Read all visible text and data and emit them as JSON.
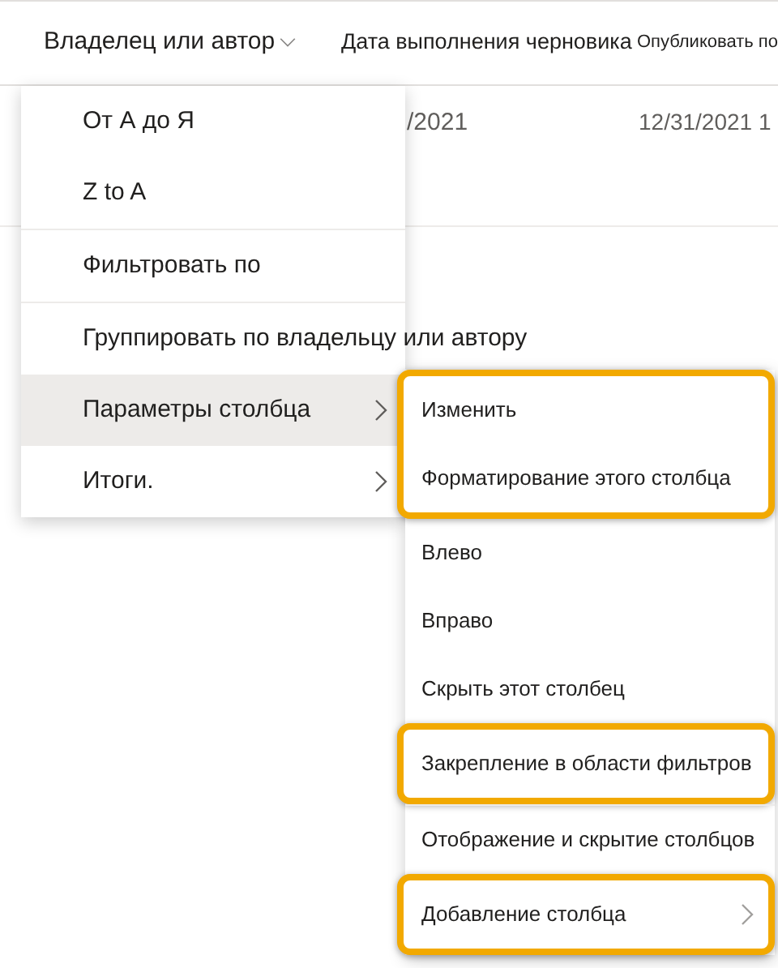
{
  "columns": [
    {
      "label": "Владелец или автор",
      "dropdown": true
    },
    {
      "label": "Дата выполнения черновика",
      "dropdown": false
    },
    {
      "label": "Опубликовать по",
      "dropdown": false
    }
  ],
  "rows": [
    {
      "column_2": "/2021",
      "column_3": "12/31/2021 1"
    }
  ],
  "menu": {
    "items": [
      {
        "kind": "item",
        "label": "От А до Я",
        "selected": false,
        "has_submenu": false
      },
      {
        "kind": "item",
        "label": "Z to A",
        "selected": false,
        "has_submenu": false
      },
      {
        "kind": "divider"
      },
      {
        "kind": "item",
        "label": "Фильтровать по",
        "selected": false,
        "has_submenu": false
      },
      {
        "kind": "divider"
      },
      {
        "kind": "item",
        "label": "Группировать по владельцу или автору",
        "selected": false,
        "has_submenu": false
      },
      {
        "kind": "item",
        "label": "Параметры столбца",
        "selected": true,
        "has_submenu": true
      },
      {
        "kind": "item",
        "label": "Итоги.",
        "selected": false,
        "has_submenu": true
      }
    ]
  },
  "submenu": {
    "items": [
      {
        "kind": "item",
        "label": "Изменить",
        "highlighted": true,
        "has_submenu": false
      },
      {
        "kind": "item",
        "label": "Форматирование этого столбца",
        "highlighted": true,
        "has_submenu": false
      },
      {
        "kind": "item",
        "label": "Влево",
        "highlighted": false,
        "has_submenu": false
      },
      {
        "kind": "item",
        "label": "Вправо",
        "highlighted": false,
        "has_submenu": false
      },
      {
        "kind": "item",
        "label": "Скрыть этот столбец",
        "highlighted": false,
        "has_submenu": false
      },
      {
        "kind": "item",
        "label": "Закрепление в области фильтров",
        "highlighted": true,
        "has_submenu": false
      },
      {
        "kind": "divider"
      },
      {
        "kind": "item",
        "label": "Отображение и скрытие столбцов",
        "highlighted": false,
        "has_submenu": false
      },
      {
        "kind": "item",
        "label": "Добавление столбца",
        "highlighted": true,
        "has_submenu": true
      }
    ]
  }
}
